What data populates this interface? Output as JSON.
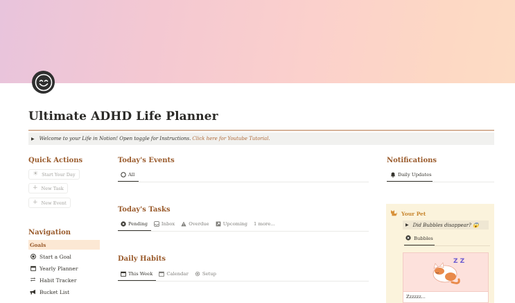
{
  "cover": {
    "colors": [
      "#e8c4dc",
      "#fbd0cc",
      "#fddcc4"
    ]
  },
  "page": {
    "icon": "smiling-face-icon",
    "title": "Ultimate ADHD Life Planner"
  },
  "welcome": {
    "text": "Welcome to your Life in Notion! Open toggle for Instructions.",
    "link": "Click here for Youtube Tutorial."
  },
  "quick_actions": {
    "heading": "Quick Actions",
    "buttons": [
      {
        "label": "Start Your Day",
        "icon": "sun-icon"
      },
      {
        "label": "New Task",
        "icon": "plus-icon"
      },
      {
        "label": "New Event",
        "icon": "plus-icon"
      }
    ]
  },
  "navigation": {
    "heading": "Navigation",
    "items": [
      {
        "label": "Goals",
        "active": true
      },
      {
        "label": "Start a Goal",
        "icon": "target-icon"
      },
      {
        "label": "Yearly Planner",
        "icon": "calendar-icon"
      },
      {
        "label": "Habit Tracker",
        "icon": "repeat-icon"
      },
      {
        "label": "Bucket List",
        "icon": "megaphone-icon"
      }
    ]
  },
  "events": {
    "heading": "Today's Events",
    "tabs": [
      {
        "label": "All",
        "icon": "circle-icon"
      }
    ]
  },
  "tasks": {
    "heading": "Today's Tasks",
    "tabs": [
      {
        "label": "Pending",
        "icon": "x-circle-icon"
      },
      {
        "label": "Inbox",
        "icon": "inbox-icon"
      },
      {
        "label": "Overdue",
        "icon": "warning-icon"
      },
      {
        "label": "Upcoming",
        "icon": "upcoming-icon"
      }
    ],
    "more": "1 more..."
  },
  "habits": {
    "heading": "Daily Habits",
    "tabs": [
      {
        "label": "This Week",
        "icon": "calendar-icon"
      },
      {
        "label": "Calendar",
        "icon": "calendar-icon"
      },
      {
        "label": "Setup",
        "icon": "gear-icon"
      }
    ]
  },
  "notifications": {
    "heading": "Notifications",
    "tabs": [
      {
        "label": "Daily Updates",
        "icon": "bell-icon"
      }
    ]
  },
  "pet": {
    "title": "Your Pet",
    "toggle": "Did Bubbles disappear? 😱",
    "tab": "Bubbles",
    "caption": "Zzzzzz...",
    "zz": "Z Z"
  },
  "colors": {
    "accent": "#9a5b2c",
    "link": "#b06c3c",
    "pet_card": "#fbf3dc"
  }
}
